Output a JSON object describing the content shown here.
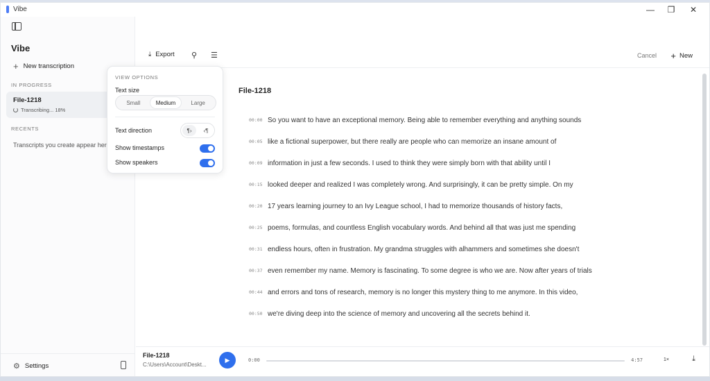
{
  "window": {
    "title": "Vibe",
    "minimize_icon": "minimize-icon",
    "maximize_icon": "restore-icon",
    "close_icon": "close-icon"
  },
  "sidebar": {
    "app_name": "Vibe",
    "new_transcription_label": "New transcription",
    "in_progress_label": "IN PROGRESS",
    "in_progress_item": {
      "name": "File-1218",
      "status": "Transcribing... 18%"
    },
    "recents_label": "RECENTS",
    "recents_empty_text": "Transcripts you create appear here",
    "settings_label": "Settings"
  },
  "toolbar": {
    "export_label": "Export",
    "cancel_label": "Cancel",
    "new_label": "New"
  },
  "document": {
    "title": "File-1218",
    "lines": [
      {
        "ts": "00:00",
        "text": "So you want to have an exceptional memory. Being able to remember everything and anything sounds"
      },
      {
        "ts": "00:05",
        "text": "like a fictional superpower, but there really are people who can memorize an insane amount of"
      },
      {
        "ts": "00:09",
        "text": "information in just a few seconds. I used to think they were simply born with that ability until I"
      },
      {
        "ts": "00:15",
        "text": "looked deeper and realized I was completely wrong. And surprisingly, it can be pretty simple. On my"
      },
      {
        "ts": "00:20",
        "text": "17 years learning journey to an Ivy League school, I had to memorize thousands of history facts,"
      },
      {
        "ts": "00:25",
        "text": "poems, formulas, and countless English vocabulary words. And behind all that was just me spending"
      },
      {
        "ts": "00:31",
        "text": "endless hours, often in frustration. My grandma struggles with alhammers and sometimes she doesn't"
      },
      {
        "ts": "00:37",
        "text": "even remember my name. Memory is fascinating. To some degree is who we are. Now after years of trials"
      },
      {
        "ts": "00:44",
        "text": "and errors and tons of research, memory is no longer this mystery thing to me anymore. In this video,"
      },
      {
        "ts": "00:50",
        "text": "we're diving deep into the science of memory and uncovering all the secrets behind it."
      }
    ]
  },
  "player": {
    "file_name": "File-1218",
    "file_path": "C:\\Users\\Account\\Deskt...",
    "current_time": "0:00",
    "duration": "4:57",
    "progress": 0,
    "speed": "1×"
  },
  "view_options": {
    "title": "VIEW OPTIONS",
    "text_size_label": "Text size",
    "sizes": [
      "Small",
      "Medium",
      "Large"
    ],
    "selected_size": "Medium",
    "text_direction_label": "Text direction",
    "show_timestamps_label": "Show timestamps",
    "show_timestamps": true,
    "show_speakers_label": "Show speakers",
    "show_speakers": true
  },
  "colors": {
    "accent": "#2f6fed"
  }
}
